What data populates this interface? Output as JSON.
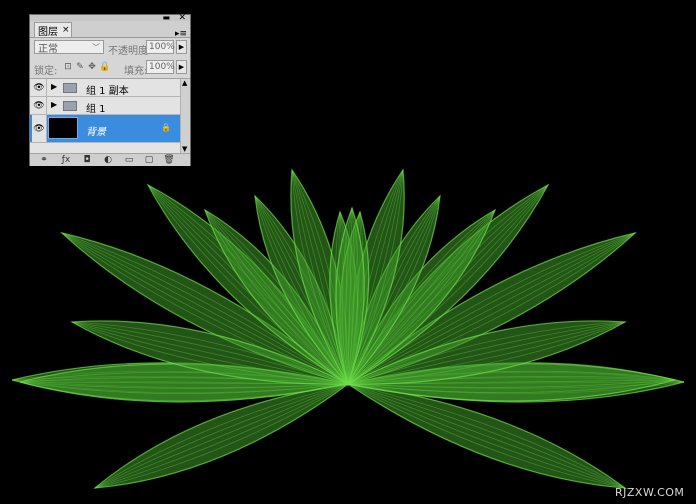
{
  "panel": {
    "tab_label": "图层",
    "tab_close": "×",
    "win_min": "▬",
    "win_close": "✕",
    "menu": "▸≡",
    "blend_mode": "正常",
    "opacity_label": "不透明度:",
    "opacity_value": "100%",
    "lock_label": "锁定:",
    "fill_label": "填充:",
    "fill_value": "100%",
    "layers": [
      {
        "name": "组 1 副本",
        "type": "group",
        "visible": true
      },
      {
        "name": "组 1",
        "type": "group",
        "visible": true
      },
      {
        "name": "背景",
        "type": "background",
        "visible": true,
        "selected": true,
        "locked": true
      }
    ],
    "bottom_icons": [
      "link-icon",
      "fx-icon",
      "mask-icon",
      "adjustment-icon",
      "new-group-icon",
      "new-layer-icon",
      "trash-icon"
    ],
    "bottom_glyphs": [
      "⚭",
      "ƒx",
      "◘",
      "◐",
      "▭",
      "▢",
      "🗑"
    ]
  },
  "canvas": {
    "background": "#000000",
    "leaf_color": "#3f9a2a",
    "leaf_highlight": "#6fe04a"
  },
  "watermark": "RJZXW.COM"
}
